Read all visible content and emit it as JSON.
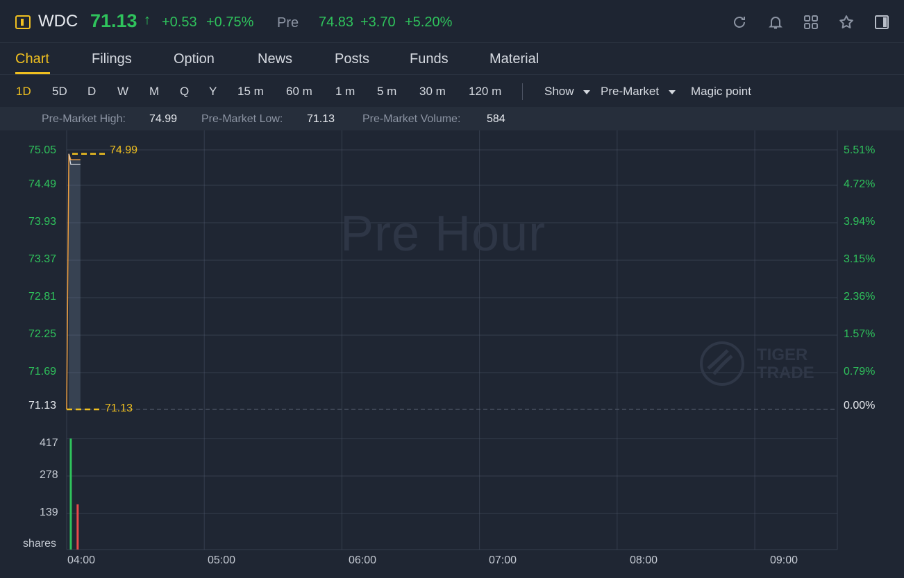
{
  "header": {
    "symbol": "WDC",
    "price": "71.13",
    "arrow": "↑",
    "change": "+0.53",
    "change_pct": "+0.75%",
    "pre_label": "Pre",
    "pre_price": "74.83",
    "pre_change": "+3.70",
    "pre_change_pct": "+5.20%",
    "icons": [
      "refresh-icon",
      "bell-icon",
      "grid-icon",
      "star-icon",
      "panel-icon"
    ],
    "accent_color": "#f0c020",
    "up_color": "#2fc35c",
    "down_color": "#e84a4a"
  },
  "tabs": [
    {
      "label": "Chart",
      "active": true
    },
    {
      "label": "Filings"
    },
    {
      "label": "Option"
    },
    {
      "label": "News"
    },
    {
      "label": "Posts"
    },
    {
      "label": "Funds"
    },
    {
      "label": "Material"
    }
  ],
  "periods": [
    "1D",
    "5D",
    "D",
    "W",
    "M",
    "Q",
    "Y",
    "15 m",
    "60 m",
    "1 m",
    "5 m",
    "30 m",
    "120 m"
  ],
  "active_period": "1D",
  "dropdowns": {
    "show": "Show",
    "session": "Pre-Market",
    "magic": "Magic point"
  },
  "stats": {
    "high_label": "Pre-Market High:",
    "high": "74.99",
    "low_label": "Pre-Market Low:",
    "low": "71.13",
    "volume_label": "Pre-Market Volume:",
    "volume": "584"
  },
  "chart": {
    "watermark": "Pre Hour",
    "logo_line1": "TIGER",
    "logo_line2": "TRADE",
    "high_marker": "74.99",
    "low_marker": "71.13",
    "volume_unit": "shares"
  },
  "chart_data": {
    "type": "line",
    "price_axis": [
      "75.05",
      "74.49",
      "73.93",
      "73.37",
      "72.81",
      "72.25",
      "71.69",
      "71.13"
    ],
    "pct_axis": [
      "5.51%",
      "4.72%",
      "3.94%",
      "3.15%",
      "2.36%",
      "1.57%",
      "0.79%",
      "0.00%"
    ],
    "volume_axis": [
      "417",
      "278",
      "139"
    ],
    "x_ticks": [
      "04:00",
      "05:00",
      "06:00",
      "07:00",
      "08:00",
      "09:00"
    ],
    "ylim": [
      71.13,
      75.05
    ],
    "x_range_hours": [
      4.0,
      9.6
    ],
    "series": [
      {
        "x": [
          4.0,
          4.016,
          4.03,
          4.05,
          4.1
        ],
        "y": [
          71.13,
          74.99,
          74.9,
          74.9,
          74.9
        ]
      }
    ],
    "average": {
      "x": [
        4.016,
        4.03,
        4.05,
        4.1
      ],
      "y": [
        74.99,
        74.83,
        74.83,
        74.83
      ]
    },
    "volume": [
      {
        "x": 4.03,
        "v": 417,
        "dir": "up"
      },
      {
        "x": 4.08,
        "v": 170,
        "dir": "down"
      }
    ],
    "volume_max": 417,
    "grid": true
  }
}
